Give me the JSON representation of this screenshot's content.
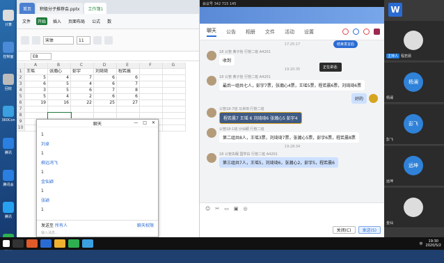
{
  "desktop": {
    "icons": [
      {
        "label": "计算"
      },
      {
        "label": "控制面"
      },
      {
        "label": "回收"
      },
      {
        "label": "360Con"
      },
      {
        "label": "腾讯"
      },
      {
        "label": "腾讯会"
      },
      {
        "label": "腾讯"
      },
      {
        "label": "腾讯"
      }
    ]
  },
  "wps": {
    "tabs": [
      {
        "label": "首页"
      },
      {
        "label": "积极分子推荐会.pptx"
      },
      {
        "label": "工作簿1"
      }
    ],
    "menu": [
      "文件",
      "开始",
      "插入",
      "页面布局",
      "公式",
      "数"
    ],
    "font": "宋体",
    "font_size": "11",
    "cell_ref": "E8",
    "col_headers": [
      "",
      "A",
      "B",
      "C",
      "D",
      "E",
      "F",
      "G"
    ],
    "rows": [
      {
        "n": "1",
        "cells": [
          "王瑶",
          "张瀚心",
          "彭宇",
          "刘琦琦",
          "程若晨",
          "",
          ""
        ]
      },
      {
        "n": "2",
        "cells": [
          "5",
          "4",
          "7",
          "6",
          "6",
          "",
          ""
        ]
      },
      {
        "n": "3",
        "cells": [
          "6",
          "5",
          "4",
          "6",
          "7",
          "",
          ""
        ]
      },
      {
        "n": "4",
        "cells": [
          "3",
          "5",
          "6",
          "7",
          "8",
          "",
          ""
        ]
      },
      {
        "n": "5",
        "cells": [
          "5",
          "4",
          "2",
          "6",
          "6",
          "",
          ""
        ]
      },
      {
        "n": "6",
        "cells": [
          "19",
          "16",
          "22",
          "25",
          "27",
          "",
          ""
        ]
      },
      {
        "n": "7",
        "cells": [
          "",
          "",
          "",
          "",
          "",
          "",
          ""
        ]
      },
      {
        "n": "8",
        "cells": [
          "",
          "",
          "",
          "",
          "",
          "",
          ""
        ]
      },
      {
        "n": "9",
        "cells": [
          "",
          "",
          "",
          "",
          "",
          "",
          ""
        ]
      },
      {
        "n": "10",
        "cells": [
          "",
          "",
          "",
          "",
          "",
          "",
          ""
        ]
      }
    ]
  },
  "minichat": {
    "title": "聊天",
    "messages": [
      {
        "text": "1",
        "name": false
      },
      {
        "text": "刘卓",
        "name": true
      },
      {
        "text": "1",
        "name": false
      },
      {
        "text": "柳远鸿飞",
        "name": true
      },
      {
        "text": "1",
        "name": false
      },
      {
        "text": "金仙颖",
        "name": true
      },
      {
        "text": "1",
        "name": false
      },
      {
        "text": "张颖",
        "name": true
      },
      {
        "text": "1",
        "name": false
      }
    ],
    "send_to_label": "发送至",
    "send_to_value": "所有人",
    "perm": "聊天权限",
    "input_placeholder": "输入消息..."
  },
  "meeting": {
    "top": "会议号 342 715 145",
    "nav": [
      "聊天",
      "公告",
      "相册",
      "文件",
      "活动",
      "设置"
    ],
    "tip": "正在讲话:",
    "tip_btn": "结束发言后",
    "messages": [
      {
        "type": "ts",
        "text": "17:25:17"
      },
      {
        "type": "other",
        "meta": "18 公管 黄子怡 行管二班 A4201",
        "text": "收到",
        "style": ""
      },
      {
        "type": "ts",
        "text": "19:20:35"
      },
      {
        "type": "other",
        "meta": "18 公管 黄子怡 行管二班 A4201",
        "text": "最后一组共七人，彭宇7票，张瀚心4票，王瑶5票，程若晨6票，刘琦琦6票",
        "style": ""
      },
      {
        "type": "mine",
        "text": "好的"
      },
      {
        "type": "other",
        "meta": "公管18-7班 马米田 行管二班",
        "text": "程若晨7 王瑶 6 刘琦琦6 张瀚心5 彭宇4",
        "style": "hl"
      },
      {
        "type": "other",
        "meta": "公管18-1班 沙仙颖 行管二班",
        "text": "第二组共8人，王瑶3票，刘琦琦7票，张瀚心5票，彭宇6票，程若晨8票",
        "style": ""
      },
      {
        "type": "ts",
        "text": "19:28:34"
      },
      {
        "type": "other",
        "meta": "18 公管失眠 国学白 行管二班 A4201",
        "text": "第三组共7人，王瑶5，刘琦琦6，张瀚心2，彭宇5，程若晨6",
        "style": "bl"
      }
    ],
    "close_btn": "关闭(C)",
    "send_btn": "发送(S)"
  },
  "video": {
    "tiles": [
      {
        "name": "程若晨",
        "tag": "主持人",
        "circle": ""
      },
      {
        "name": "杨澜",
        "tag": "",
        "circle": "杨澜"
      },
      {
        "name": "彭飞",
        "tag": "",
        "circle": "彭飞"
      },
      {
        "name": "远坤",
        "tag": "",
        "circle": "远坤"
      },
      {
        "name": "金仙",
        "tag": "",
        "circle": ""
      }
    ]
  },
  "taskbar": {
    "time": "19:30",
    "date": "2020/5/2",
    "lang": "中"
  }
}
